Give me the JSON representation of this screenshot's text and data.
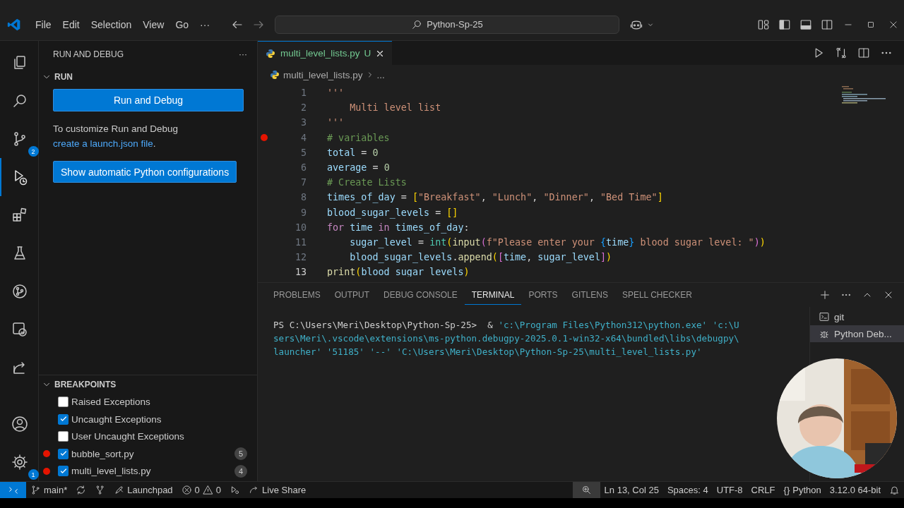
{
  "title_bar": {
    "menu": [
      "File",
      "Edit",
      "Selection",
      "View",
      "Go",
      "···"
    ],
    "search": "Python-Sp-25"
  },
  "activity_bar": {
    "items": [
      {
        "kind": "explorer",
        "selected": false
      },
      {
        "kind": "search",
        "selected": false
      },
      {
        "kind": "source-control",
        "selected": false,
        "badge": "2"
      },
      {
        "kind": "run-debug",
        "selected": true
      },
      {
        "kind": "extensions",
        "selected": false
      },
      {
        "kind": "testing",
        "selected": false
      },
      {
        "kind": "git-graph",
        "selected": false
      },
      {
        "kind": "remote",
        "selected": false
      },
      {
        "kind": "live-share",
        "selected": false
      }
    ],
    "bottom": [
      {
        "kind": "account"
      },
      {
        "kind": "settings",
        "badge": "1"
      }
    ]
  },
  "sidebar": {
    "title": "RUN AND DEBUG",
    "more": "···",
    "run_section": {
      "title": "RUN",
      "expanded": true,
      "button": "Run and Debug",
      "text": "To customize Run and Debug ",
      "link": "create a launch.json file",
      "after": ".",
      "button_2": "Show automatic Python configurations"
    },
    "breakpoints": {
      "title": "BREAKPOINTS",
      "expanded": true,
      "items": [
        {
          "label": "Raised Exceptions",
          "checked": false,
          "breakpoint": false
        },
        {
          "label": "Uncaught Exceptions",
          "checked": true,
          "breakpoint": false
        },
        {
          "label": "User Uncaught Exceptions",
          "checked": false,
          "breakpoint": false
        },
        {
          "label": "bubble_sort.py",
          "checked": true,
          "breakpoint": true,
          "count": "5"
        },
        {
          "label": "multi_level_lists.py",
          "checked": true,
          "breakpoint": true,
          "count": "4"
        }
      ]
    }
  },
  "editor": {
    "tabs": [
      {
        "label": "multi_level_lists.py",
        "status": "U",
        "selected": true
      }
    ],
    "breadcrumb": [
      "multi_level_lists.py",
      "..."
    ],
    "lines": [
      {
        "number": "1",
        "breakpoint": false,
        "current": false,
        "tokens": [
          {
            "kind": "string",
            "text": "'''"
          }
        ]
      },
      {
        "number": "2",
        "breakpoint": false,
        "current": false,
        "tokens": [
          {
            "kind": "string",
            "text": "    Multi level list"
          }
        ]
      },
      {
        "number": "3",
        "breakpoint": false,
        "current": false,
        "tokens": [
          {
            "kind": "string",
            "text": "'''"
          }
        ]
      },
      {
        "number": "4",
        "breakpoint": true,
        "current": false,
        "tokens": [
          {
            "kind": "comment",
            "text": "# variables"
          }
        ]
      },
      {
        "number": "5",
        "breakpoint": false,
        "current": false,
        "tokens": [
          {
            "kind": "variable",
            "text": "total"
          },
          {
            "kind": "plain",
            "text": " = "
          },
          {
            "kind": "number",
            "text": "0"
          }
        ]
      },
      {
        "number": "6",
        "breakpoint": false,
        "current": false,
        "tokens": [
          {
            "kind": "variable",
            "text": "average"
          },
          {
            "kind": "plain",
            "text": " = "
          },
          {
            "kind": "number",
            "text": "0"
          }
        ]
      },
      {
        "number": "7",
        "breakpoint": false,
        "current": false,
        "tokens": [
          {
            "kind": "comment",
            "text": "# Create Lists"
          }
        ]
      },
      {
        "number": "8",
        "breakpoint": false,
        "current": false,
        "tokens": [
          {
            "kind": "variable",
            "text": "times_of_day"
          },
          {
            "kind": "plain",
            "text": " = "
          },
          {
            "kind": "bracket",
            "text": "["
          },
          {
            "kind": "string",
            "text": "\"Breakfast\""
          },
          {
            "kind": "plain",
            "text": ", "
          },
          {
            "kind": "string",
            "text": "\"Lunch\""
          },
          {
            "kind": "plain",
            "text": ", "
          },
          {
            "kind": "string",
            "text": "\"Dinner\""
          },
          {
            "kind": "plain",
            "text": ", "
          },
          {
            "kind": "string",
            "text": "\"Bed Time\""
          },
          {
            "kind": "bracket",
            "text": "]"
          }
        ]
      },
      {
        "number": "9",
        "breakpoint": false,
        "current": false,
        "tokens": [
          {
            "kind": "variable",
            "text": "blood_sugar_levels"
          },
          {
            "kind": "plain",
            "text": " = "
          },
          {
            "kind": "bracket",
            "text": "[]"
          }
        ]
      },
      {
        "number": "10",
        "breakpoint": false,
        "current": false,
        "tokens": [
          {
            "kind": "keyword",
            "text": "for"
          },
          {
            "kind": "variable",
            "text": " time"
          },
          {
            "kind": "keyword",
            "text": " in"
          },
          {
            "kind": "variable",
            "text": " times_of_day"
          },
          {
            "kind": "plain",
            "text": ":"
          }
        ]
      },
      {
        "number": "11",
        "breakpoint": false,
        "current": false,
        "tokens": [
          {
            "kind": "variable",
            "text": "    sugar_level"
          },
          {
            "kind": "plain",
            "text": " = "
          },
          {
            "kind": "type",
            "text": "int"
          },
          {
            "kind": "bracket",
            "text": "("
          },
          {
            "kind": "function",
            "text": "input"
          },
          {
            "kind": "bracket2",
            "text": "("
          },
          {
            "kind": "string",
            "text": "f\"Please enter your "
          },
          {
            "kind": "bracket3",
            "text": "{"
          },
          {
            "kind": "variable",
            "text": "time"
          },
          {
            "kind": "bracket3",
            "text": "}"
          },
          {
            "kind": "string",
            "text": " blood sugar level: \""
          },
          {
            "kind": "bracket2",
            "text": ")"
          },
          {
            "kind": "bracket",
            "text": ")"
          }
        ]
      },
      {
        "number": "12",
        "breakpoint": false,
        "current": false,
        "tokens": [
          {
            "kind": "variable",
            "text": "    blood_sugar_levels"
          },
          {
            "kind": "plain",
            "text": "."
          },
          {
            "kind": "function",
            "text": "append"
          },
          {
            "kind": "bracket",
            "text": "("
          },
          {
            "kind": "bracket2",
            "text": "["
          },
          {
            "kind": "variable",
            "text": "time"
          },
          {
            "kind": "plain",
            "text": ", "
          },
          {
            "kind": "variable",
            "text": "sugar_level"
          },
          {
            "kind": "bracket2",
            "text": "]"
          },
          {
            "kind": "bracket",
            "text": ")"
          }
        ]
      },
      {
        "number": "13",
        "breakpoint": false,
        "current": true,
        "tokens": [
          {
            "kind": "function",
            "text": "print"
          },
          {
            "kind": "bracket",
            "text": "("
          },
          {
            "kind": "variable",
            "text": "blood_sugar_levels"
          },
          {
            "kind": "bracket",
            "text": ")"
          }
        ]
      }
    ]
  },
  "panel": {
    "tabs": [
      {
        "label": "PROBLEMS",
        "selected": false
      },
      {
        "label": "OUTPUT",
        "selected": false
      },
      {
        "label": "DEBUG CONSOLE",
        "selected": false
      },
      {
        "label": "TERMINAL",
        "selected": true
      },
      {
        "label": "PORTS",
        "selected": false
      },
      {
        "label": "GITLENS",
        "selected": false
      },
      {
        "label": "SPELL CHECKER",
        "selected": false
      }
    ],
    "terminal_lines": [
      [
        {
          "kind": "prompt",
          "text": "PS C:\\Users\\Meri\\Desktop\\Python-Sp-25>  & "
        },
        {
          "kind": "string",
          "text": "'c:\\Program Files\\Python312\\python.exe' 'c:\\U"
        }
      ],
      [
        {
          "kind": "string",
          "text": "sers\\Meri\\.vscode\\extensions\\ms-python.debugpy-2025.0.1-win32-x64\\bundled\\libs\\debugpy\\"
        }
      ],
      [
        {
          "kind": "string",
          "text": "launcher' '51185' '--' 'C:\\Users\\Meri\\Desktop\\Python-Sp-25\\multi_level_lists.py'"
        }
      ]
    ],
    "terminals": [
      {
        "kind": "shell",
        "label": "git",
        "selected": false
      },
      {
        "kind": "debug",
        "label": "Python Deb...",
        "selected": true
      }
    ]
  },
  "status_bar": {
    "branch": "main*",
    "launchpad": "Launchpad",
    "errors": "0",
    "warnings": "0",
    "live_share": "Live Share",
    "position": "Ln 13, Col 25",
    "spaces": "Spaces: 4",
    "encoding": "UTF-8",
    "eol": "CRLF",
    "language_icon": "{}",
    "language": "Python",
    "interpreter": "3.12.0 64-bit"
  }
}
